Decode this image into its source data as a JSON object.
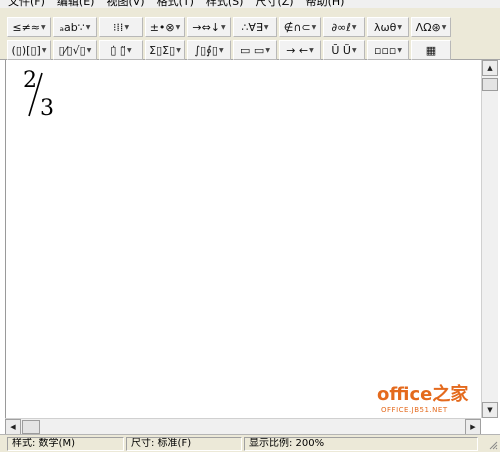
{
  "menu": {
    "items": [
      "文件(F)",
      "编辑(E)",
      "视图(V)",
      "格式(T)",
      "样式(S)",
      "尺寸(Z)",
      "帮助(H)"
    ]
  },
  "toolbar": {
    "row1": [
      "≤≠≈",
      "ₐab∵",
      "⁝⁞⁞",
      "±•⊗",
      "→⇔↓",
      "∴∀∃",
      "∉∩⊂",
      "∂∞ℓ",
      "λωθ",
      "ΛΩ⊛"
    ],
    "row2": [
      "(▯)[▯]",
      "▯⁄▯√▯",
      "▯̇ ▯̈",
      "Σ▯Σ▯",
      "∫▯∮▯",
      "▭ ▭",
      "→ ←",
      "Ū Ũ",
      "▫▫▫",
      "▦"
    ]
  },
  "document": {
    "fraction": {
      "numerator": "2",
      "denominator": "3"
    }
  },
  "statusbar": {
    "style": "样式: 数学(M)",
    "size": "尺寸: 标准(F)",
    "zoom": "显示比例: 200%"
  },
  "watermark": {
    "main": "office之家",
    "sub": "OFFICE.JB51.NET"
  },
  "colors": {
    "toolbar_bg": "#ece9d8",
    "watermark": "#e46a1d"
  }
}
